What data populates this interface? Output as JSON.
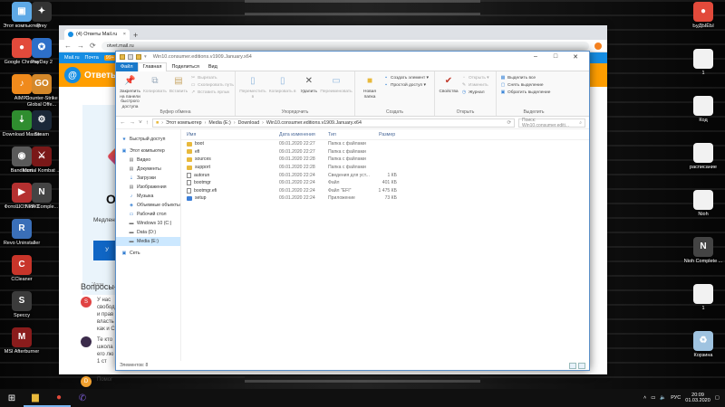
{
  "desktop": {
    "icons_left": [
      {
        "label": "Этот компьютер",
        "icon": "computer-icon",
        "color": "#5ea9e6",
        "glyph": "▣"
      },
      {
        "label": "Google Chrome",
        "icon": "chrome-icon",
        "color": "#e24a3b",
        "glyph": "●"
      },
      {
        "label": "AIMP3",
        "icon": "aimp-icon",
        "color": "#f08a1c",
        "glyph": "♪"
      },
      {
        "label": "Download Master",
        "icon": "download-master-icon",
        "color": "#2f8d2f",
        "glyph": "⇣"
      },
      {
        "label": "Bandicam",
        "icon": "bandicam-icon",
        "color": "#5a5a5a",
        "glyph": "◉"
      },
      {
        "label": "ФотоШОУ PRO",
        "icon": "fotoshow-icon",
        "color": "#b43030",
        "glyph": "▶"
      },
      {
        "label": "Revo Uninstaller",
        "icon": "revo-icon",
        "color": "#3a6fb8",
        "glyph": "R"
      },
      {
        "label": "CCleaner",
        "icon": "ccleaner-icon",
        "color": "#c8352a",
        "glyph": "C"
      },
      {
        "label": "Speccy",
        "icon": "speccy-icon",
        "color": "#3b3b3b",
        "glyph": "S"
      },
      {
        "label": "MSI Afterburner",
        "icon": "msi-afterburner-icon",
        "color": "#8a1c1c",
        "glyph": "M"
      }
    ],
    "icons_col2": [
      {
        "label": "Prey",
        "icon": "prey-icon",
        "color": "#333333",
        "glyph": "✦"
      },
      {
        "label": "PayDay 2",
        "icon": "payday-icon",
        "color": "#2d6fc8",
        "glyph": "✪"
      },
      {
        "label": "Counter-Strike Global Offe...",
        "icon": "csgo-icon",
        "color": "#d4882a",
        "glyph": "GO"
      },
      {
        "label": "Steam",
        "icon": "steam-icon",
        "color": "#1b2838",
        "glyph": "⚙"
      },
      {
        "label": "Mortal Kombat ...",
        "icon": "mortal-kombat-icon",
        "color": "#7a1818",
        "glyph": "⚔"
      },
      {
        "label": "Nioh Comple...",
        "icon": "nioh-icon",
        "color": "#444444",
        "glyph": "N"
      }
    ],
    "icons_right": [
      {
        "label": "ЬуДЫЁЫ",
        "icon": "chrome-icon",
        "color": "#e24a3b",
        "glyph": "●"
      },
      {
        "label": "1",
        "icon": "document-icon",
        "color": "#f2f2f2",
        "glyph": ""
      },
      {
        "label": "Код",
        "icon": "document-icon",
        "color": "#f2f2f2",
        "glyph": ""
      },
      {
        "label": "расписание",
        "icon": "document-icon",
        "color": "#f2f2f2",
        "glyph": ""
      },
      {
        "label": "Nioh",
        "icon": "document-icon",
        "color": "#f2f2f2",
        "glyph": ""
      },
      {
        "label": "Nioh Complete ...",
        "icon": "nioh-icon",
        "color": "#444444",
        "glyph": "N"
      },
      {
        "label": "1",
        "icon": "document-icon",
        "color": "#f2f2f2",
        "glyph": ""
      },
      {
        "label": "Корзина",
        "icon": "recycle-bin-icon",
        "color": "#9fc3e0",
        "glyph": "♻"
      }
    ]
  },
  "browser": {
    "tab_title": "(4) Ответы Mail.ru",
    "url": "otvet.mail.ru",
    "top_links": [
      "Mail.ru",
      "Почта",
      "99+"
    ],
    "brand": "Ответы",
    "promo_brand": "O",
    "promo_text": "Медлене проблем...",
    "promo_button": "У",
    "promo_footer": "\"Атом",
    "questions_title": "Вопросы-...",
    "questions": [
      {
        "avatar": "S",
        "color": "#e04343",
        "text": "У нас свобод и прав власть как и С"
      },
      {
        "avatar": "",
        "color": "#3b2b4b",
        "text": "Те кто школа его лю 1 ст"
      },
      {
        "avatar": "D",
        "color": "#f0a030",
        "text": "Помог"
      }
    ]
  },
  "explorer": {
    "title": "Win10.consumer.editions.v1909.January.x64",
    "window_controls": [
      "–",
      "□",
      "✕"
    ],
    "ribbon_tabs": [
      "Файл",
      "Главная",
      "Поделиться",
      "Вид"
    ],
    "groups": {
      "clipboard": {
        "name": "Буфер обмена",
        "pin": "Закрепить на панели быстрого доступа",
        "copy": "Копировать",
        "paste": "Вставить",
        "cut": "Вырезать",
        "copy_path": "Скопировать путь",
        "paste_shortcut": "Вставить ярлык"
      },
      "organize": {
        "name": "Упорядочить",
        "move": "Переместить в",
        "copy_to": "Копировать в",
        "delete": "Удалить",
        "rename": "Переименовать"
      },
      "new": {
        "name": "Создать",
        "new_folder": "Новая папка",
        "new_item": "Создать элемент ▾",
        "easy_access": "Простой доступ ▾"
      },
      "open": {
        "name": "Открыть",
        "properties": "Свойства",
        "open": "Открыть ▾",
        "edit": "Изменить",
        "history": "Журнал"
      },
      "select": {
        "name": "Выделить",
        "select_all": "Выделить все",
        "select_none": "Снять выделение",
        "invert": "Обратить выделение"
      }
    },
    "breadcrumb": [
      "Этот компьютер",
      "Media (E:)",
      "Download",
      "Win10.consumer.editions.v1909.January.x64"
    ],
    "search_placeholder": "Поиск: Win10.consumer.editi...",
    "nav": [
      {
        "label": "Быстрый доступ",
        "icon": "star-icon",
        "glyph": "★",
        "color": "#2f7bd0"
      },
      {
        "label": "Этот компьютер",
        "icon": "computer-icon",
        "glyph": "▣",
        "color": "#3b86d8"
      },
      {
        "label": "Видео",
        "icon": "video-folder-icon",
        "glyph": "▤",
        "color": "#6b6b6b"
      },
      {
        "label": "Документы",
        "icon": "documents-folder-icon",
        "glyph": "▤",
        "color": "#6b6b6b"
      },
      {
        "label": "Загрузки",
        "icon": "downloads-folder-icon",
        "glyph": "⇣",
        "color": "#2f7bd0"
      },
      {
        "label": "Изображения",
        "icon": "pictures-folder-icon",
        "glyph": "▤",
        "color": "#6b6b6b"
      },
      {
        "label": "Музыка",
        "icon": "music-folder-icon",
        "glyph": "♪",
        "color": "#2f7bd0"
      },
      {
        "label": "Объемные объекты",
        "icon": "3d-objects-icon",
        "glyph": "◈",
        "color": "#2f7bd0"
      },
      {
        "label": "Рабочий стол",
        "icon": "desktop-folder-icon",
        "glyph": "▭",
        "color": "#2f7bd0"
      },
      {
        "label": "Windows 10 (C:)",
        "icon": "drive-icon",
        "glyph": "▬",
        "color": "#6b6b6b"
      },
      {
        "label": "Data (D:)",
        "icon": "drive-icon",
        "glyph": "▬",
        "color": "#6b6b6b"
      },
      {
        "label": "Media (E:)",
        "icon": "drive-icon",
        "glyph": "▬",
        "color": "#6b6b6b"
      },
      {
        "label": "Сеть",
        "icon": "network-icon",
        "glyph": "▣",
        "color": "#2f7bd0"
      }
    ],
    "columns": [
      "Имя",
      "Дата изменения",
      "Тип",
      "Размер"
    ],
    "files": [
      {
        "name": "boot",
        "date": "09.01.2020 22:27",
        "type": "Папка с файлами",
        "size": "",
        "kind": "folder"
      },
      {
        "name": "efi",
        "date": "09.01.2020 22:27",
        "type": "Папка с файлами",
        "size": "",
        "kind": "folder"
      },
      {
        "name": "sources",
        "date": "09.01.2020 22:28",
        "type": "Папка с файлами",
        "size": "",
        "kind": "folder"
      },
      {
        "name": "support",
        "date": "09.01.2020 22:28",
        "type": "Папка с файлами",
        "size": "",
        "kind": "folder"
      },
      {
        "name": "autorun",
        "date": "09.01.2020 22:24",
        "type": "Сведения для уст...",
        "size": "1 КБ",
        "kind": "file"
      },
      {
        "name": "bootmgr",
        "date": "09.01.2020 22:24",
        "type": "Файл",
        "size": "401 КБ",
        "kind": "file"
      },
      {
        "name": "bootmgr.efi",
        "date": "09.01.2020 22:24",
        "type": "Файл \"EFI\"",
        "size": "1 475 КБ",
        "kind": "file"
      },
      {
        "name": "setup",
        "date": "09.01.2020 22:24",
        "type": "Приложение",
        "size": "73 КБ",
        "kind": "setup"
      }
    ],
    "status": "Элементов: 8"
  },
  "taskbar": {
    "apps": [
      {
        "icon": "windows-start-icon",
        "glyph": "⊞"
      },
      {
        "icon": "file-explorer-icon",
        "glyph": "▆"
      },
      {
        "icon": "chrome-icon",
        "glyph": "●"
      },
      {
        "icon": "viber-icon",
        "glyph": "✆"
      }
    ],
    "language": "РУС",
    "time": "20:09",
    "date": "01.03.2020"
  },
  "colors": {
    "accent": "#1979ca",
    "mailru_orange": "#ff9e00",
    "mailru_blue": "#168de2"
  }
}
